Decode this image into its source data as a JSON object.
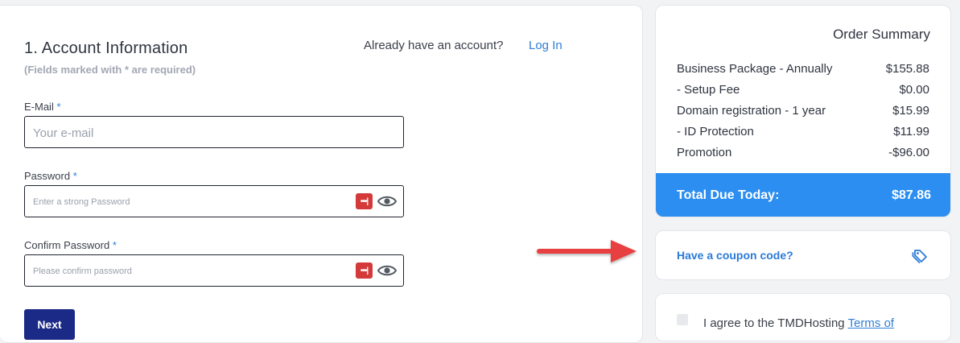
{
  "account": {
    "title": "1. Account Information",
    "required_note": "(Fields marked with * are required)",
    "login_question": "Already have an account?",
    "login_link": "Log In",
    "email": {
      "label": "E-Mail",
      "placeholder": "Your e-mail"
    },
    "password": {
      "label": "Password",
      "placeholder": "Enter a strong Password"
    },
    "confirm": {
      "label": "Confirm Password",
      "placeholder": "Please confirm password"
    },
    "required_mark": "*",
    "next_label": "Next",
    "password_manager_icon_text": "•••|"
  },
  "summary": {
    "title": "Order Summary",
    "items": [
      {
        "label": "Business Package - Annually",
        "amount": "$155.88"
      },
      {
        "label": "- Setup Fee",
        "amount": "$0.00"
      },
      {
        "label": "Domain registration - 1 year",
        "amount": "$15.99"
      },
      {
        "label": "- ID Protection",
        "amount": "$11.99"
      },
      {
        "label": "Promotion",
        "amount": "-$96.00"
      }
    ],
    "total_label": "Total Due Today:",
    "total_amount": "$87.86"
  },
  "coupon": {
    "label": "Have a coupon code?"
  },
  "terms": {
    "text": "I agree to the TMDHosting",
    "link": "Terms of"
  },
  "colors": {
    "accent_blue": "#2b8ef0",
    "link_blue": "#2f7fd6",
    "next_button": "#1b2a86",
    "arrow_red": "#e8403f",
    "password_manager_red": "#d53a3a"
  },
  "icons": [
    "password-manager-icon",
    "eye-icon",
    "tag-icon",
    "red-arrow-annotation"
  ]
}
